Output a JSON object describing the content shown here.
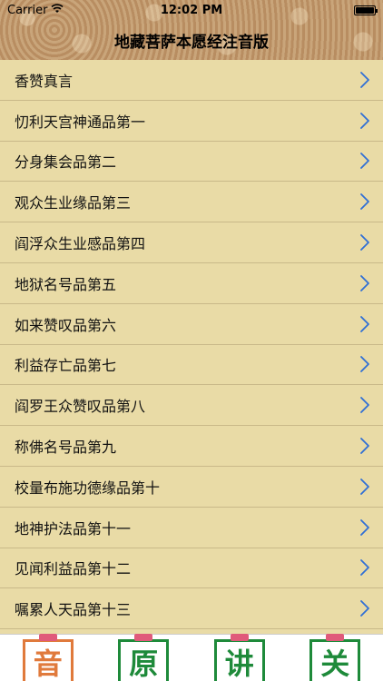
{
  "status_bar": {
    "carrier": "Carrier",
    "time": "12:02 PM",
    "battery_level": 1.0
  },
  "nav": {
    "title": "地藏菩萨本愿经注音版"
  },
  "list": {
    "items": [
      {
        "label": "香赞真言"
      },
      {
        "label": "忉利天宫神通品第一"
      },
      {
        "label": "分身集会品第二"
      },
      {
        "label": "观众生业缘品第三"
      },
      {
        "label": "阎浮众生业感品第四"
      },
      {
        "label": "地狱名号品第五"
      },
      {
        "label": "如来赞叹品第六"
      },
      {
        "label": "利益存亡品第七"
      },
      {
        "label": "阎罗王众赞叹品第八"
      },
      {
        "label": "称佛名号品第九"
      },
      {
        "label": "校量布施功德缘品第十"
      },
      {
        "label": "地神护法品第十一"
      },
      {
        "label": "见闻利益品第十二"
      },
      {
        "label": "嘱累人天品第十三"
      }
    ]
  },
  "tabbar": {
    "tabs": [
      {
        "glyph": "音",
        "color": "#e07a3c",
        "icon": "yin-tab-icon"
      },
      {
        "glyph": "原",
        "color": "#1e8a3a",
        "icon": "yuan-tab-icon"
      },
      {
        "glyph": "讲",
        "color": "#1e8a3a",
        "icon": "jiang-tab-icon"
      },
      {
        "glyph": "关",
        "color": "#1e8a3a",
        "icon": "guan-tab-icon"
      }
    ]
  },
  "colors": {
    "list_background": "#e9dba6",
    "chevron": "#2f6fd6",
    "header_brown": "#c49a6e",
    "tab_tag": "#e05a7a"
  }
}
